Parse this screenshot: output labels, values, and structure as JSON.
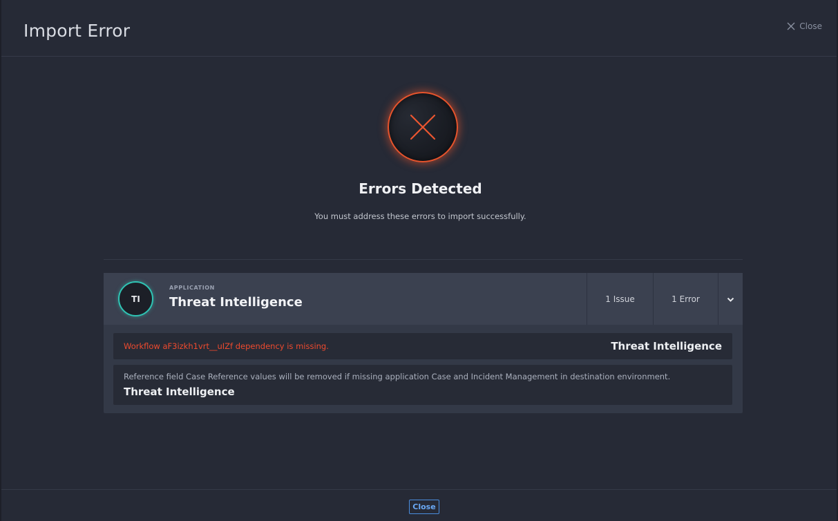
{
  "header": {
    "title": "Import Error",
    "close_label": "Close"
  },
  "hero": {
    "title": "Errors Detected",
    "subtitle": "You must address these errors to import successfully."
  },
  "application": {
    "kicker": "APPLICATION",
    "avatar_initials": "TI",
    "name": "Threat Intelligence",
    "issues_label": "1 Issue",
    "errors_label": "1 Error",
    "items": [
      {
        "severity": "error",
        "message": "Workflow aF3izkh1vrt__uIZf dependency is missing.",
        "app": "Threat Intelligence"
      },
      {
        "severity": "warning",
        "message": "Reference field Case Reference values will be removed if missing application Case and Incident Management in destination environment.",
        "app": "Threat Intelligence"
      }
    ]
  },
  "footer": {
    "close_label": "Close"
  },
  "colors": {
    "background": "#262a36",
    "error": "#ee4a2e",
    "accent_teal": "#2fc4b4",
    "link_blue": "#6aa9f5"
  },
  "icons": {
    "header_close": "close-icon",
    "hero": "error-x-icon",
    "expand": "chevron-down-icon"
  }
}
